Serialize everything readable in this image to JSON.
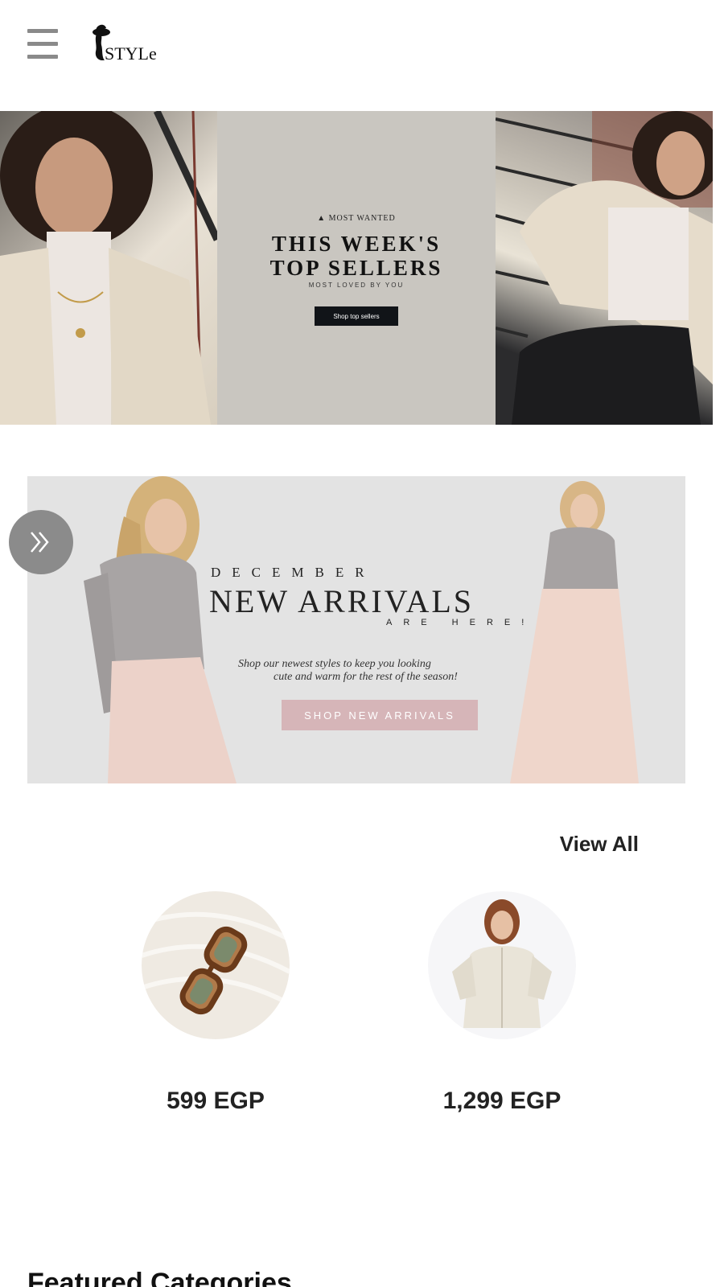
{
  "header": {
    "logo_text": "STYLe"
  },
  "hero": {
    "eyebrow": "MOST WANTED",
    "title_line1": "THIS WEEK'S",
    "title_line2": "TOP SELLERS",
    "subtitle": "MOST LOVED BY YOU",
    "button_label": "Shop top sellers"
  },
  "arrivals": {
    "month": "DECEMBER",
    "title": "NEW ARRIVALS",
    "tag": "ARE HERE!",
    "text_line1": "Shop our newest styles to keep you looking",
    "text_line2": "cute and warm for the rest of the season!",
    "button_label": "SHOP NEW ARRIVALS"
  },
  "products": {
    "view_all_label": "View All",
    "items": [
      {
        "price": "599 EGP"
      },
      {
        "price": "1,299 EGP"
      }
    ]
  },
  "featured": {
    "title": "Featured Categories"
  },
  "colors": {
    "hero_button": "#111418",
    "arrivals_button": "#d6b5b8",
    "carousel_button": "#8b8b8b"
  }
}
